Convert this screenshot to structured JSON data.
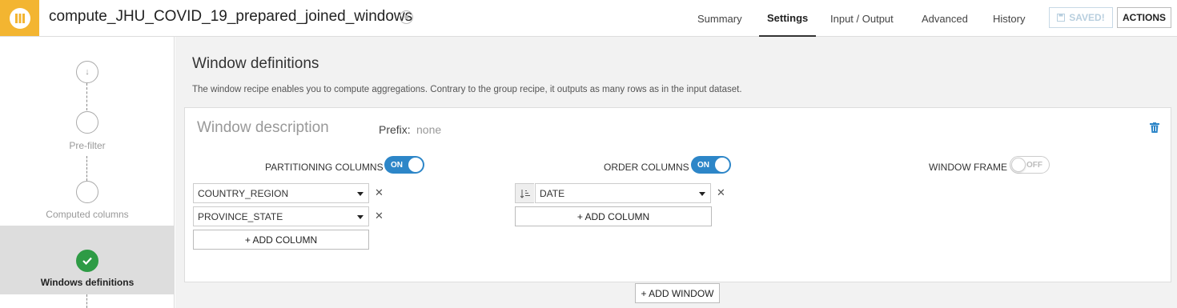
{
  "header": {
    "recipe_name": "compute_JHU_COVID_19_prepared_joined_windows",
    "tabs": [
      {
        "label": "Summary"
      },
      {
        "label": "Settings",
        "active": true
      },
      {
        "label": "Input / Output"
      },
      {
        "label": "Advanced"
      },
      {
        "label": "History"
      }
    ],
    "saved_label": "SAVED!",
    "actions_label": "ACTIONS"
  },
  "sidebar": {
    "steps": [
      {
        "label": ""
      },
      {
        "label": "Pre-filter"
      },
      {
        "label": "Computed columns"
      },
      {
        "label": "Windows definitions",
        "active": true,
        "done": true
      }
    ]
  },
  "main": {
    "title": "Window definitions",
    "description": "The window recipe enables you to compute aggregations. Contrary to the group recipe, it outputs as many rows as in the input dataset.",
    "window": {
      "title": "Window description",
      "prefix_label": "Prefix:",
      "prefix_value": "none",
      "partitioning": {
        "label": "PARTITIONING COLUMNS",
        "toggle": "ON",
        "columns": [
          "COUNTRY_REGION",
          "PROVINCE_STATE"
        ],
        "add_label": "+ ADD COLUMN"
      },
      "order": {
        "label": "ORDER COLUMNS",
        "toggle": "ON",
        "columns": [
          "DATE"
        ],
        "add_label": "+ ADD COLUMN"
      },
      "frame": {
        "label": "WINDOW FRAME",
        "toggle": "OFF"
      }
    },
    "add_window_label": "+ ADD WINDOW"
  },
  "colors": {
    "brand": "#f3b531",
    "toggle_on": "#2d86c8",
    "success": "#2e9b45"
  }
}
